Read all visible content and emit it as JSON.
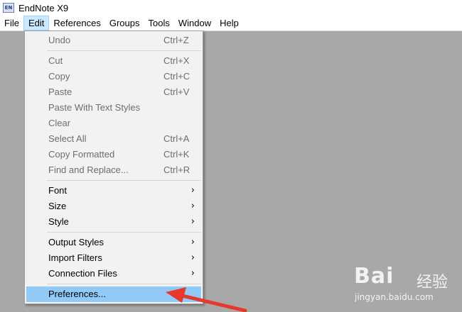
{
  "window": {
    "app_icon_text": "EN",
    "title": "EndNote X9"
  },
  "menubar": [
    {
      "label": "File"
    },
    {
      "label": "Edit"
    },
    {
      "label": "References"
    },
    {
      "label": "Groups"
    },
    {
      "label": "Tools"
    },
    {
      "label": "Window"
    },
    {
      "label": "Help"
    }
  ],
  "active_menu": "Edit",
  "edit_menu": {
    "undo": {
      "label": "Undo",
      "shortcut": "Ctrl+Z",
      "enabled": false
    },
    "cut": {
      "label": "Cut",
      "shortcut": "Ctrl+X",
      "enabled": false
    },
    "copy": {
      "label": "Copy",
      "shortcut": "Ctrl+C",
      "enabled": false
    },
    "paste": {
      "label": "Paste",
      "shortcut": "Ctrl+V",
      "enabled": false
    },
    "paste_styles": {
      "label": "Paste With Text Styles",
      "enabled": false
    },
    "clear": {
      "label": "Clear",
      "enabled": false
    },
    "select_all": {
      "label": "Select All",
      "shortcut": "Ctrl+A",
      "enabled": false
    },
    "copy_formatted": {
      "label": "Copy Formatted",
      "shortcut": "Ctrl+K",
      "enabled": false
    },
    "find_replace": {
      "label": "Find and Replace...",
      "shortcut": "Ctrl+R",
      "enabled": false
    },
    "font": {
      "label": "Font",
      "submenu": true
    },
    "size": {
      "label": "Size",
      "submenu": true
    },
    "style": {
      "label": "Style",
      "submenu": true
    },
    "output_styles": {
      "label": "Output Styles",
      "submenu": true
    },
    "import_filters": {
      "label": "Import Filters",
      "submenu": true
    },
    "connection_files": {
      "label": "Connection Files",
      "submenu": true
    },
    "preferences": {
      "label": "Preferences...",
      "highlighted": true
    }
  },
  "submenu_glyph": "›",
  "annotation": {
    "icon": "red-arrow-icon",
    "color": "#e8382c"
  },
  "watermark": {
    "main": "Bai",
    "paw": "du",
    "cn": "经验",
    "url": "jingyan.baidu.com"
  }
}
